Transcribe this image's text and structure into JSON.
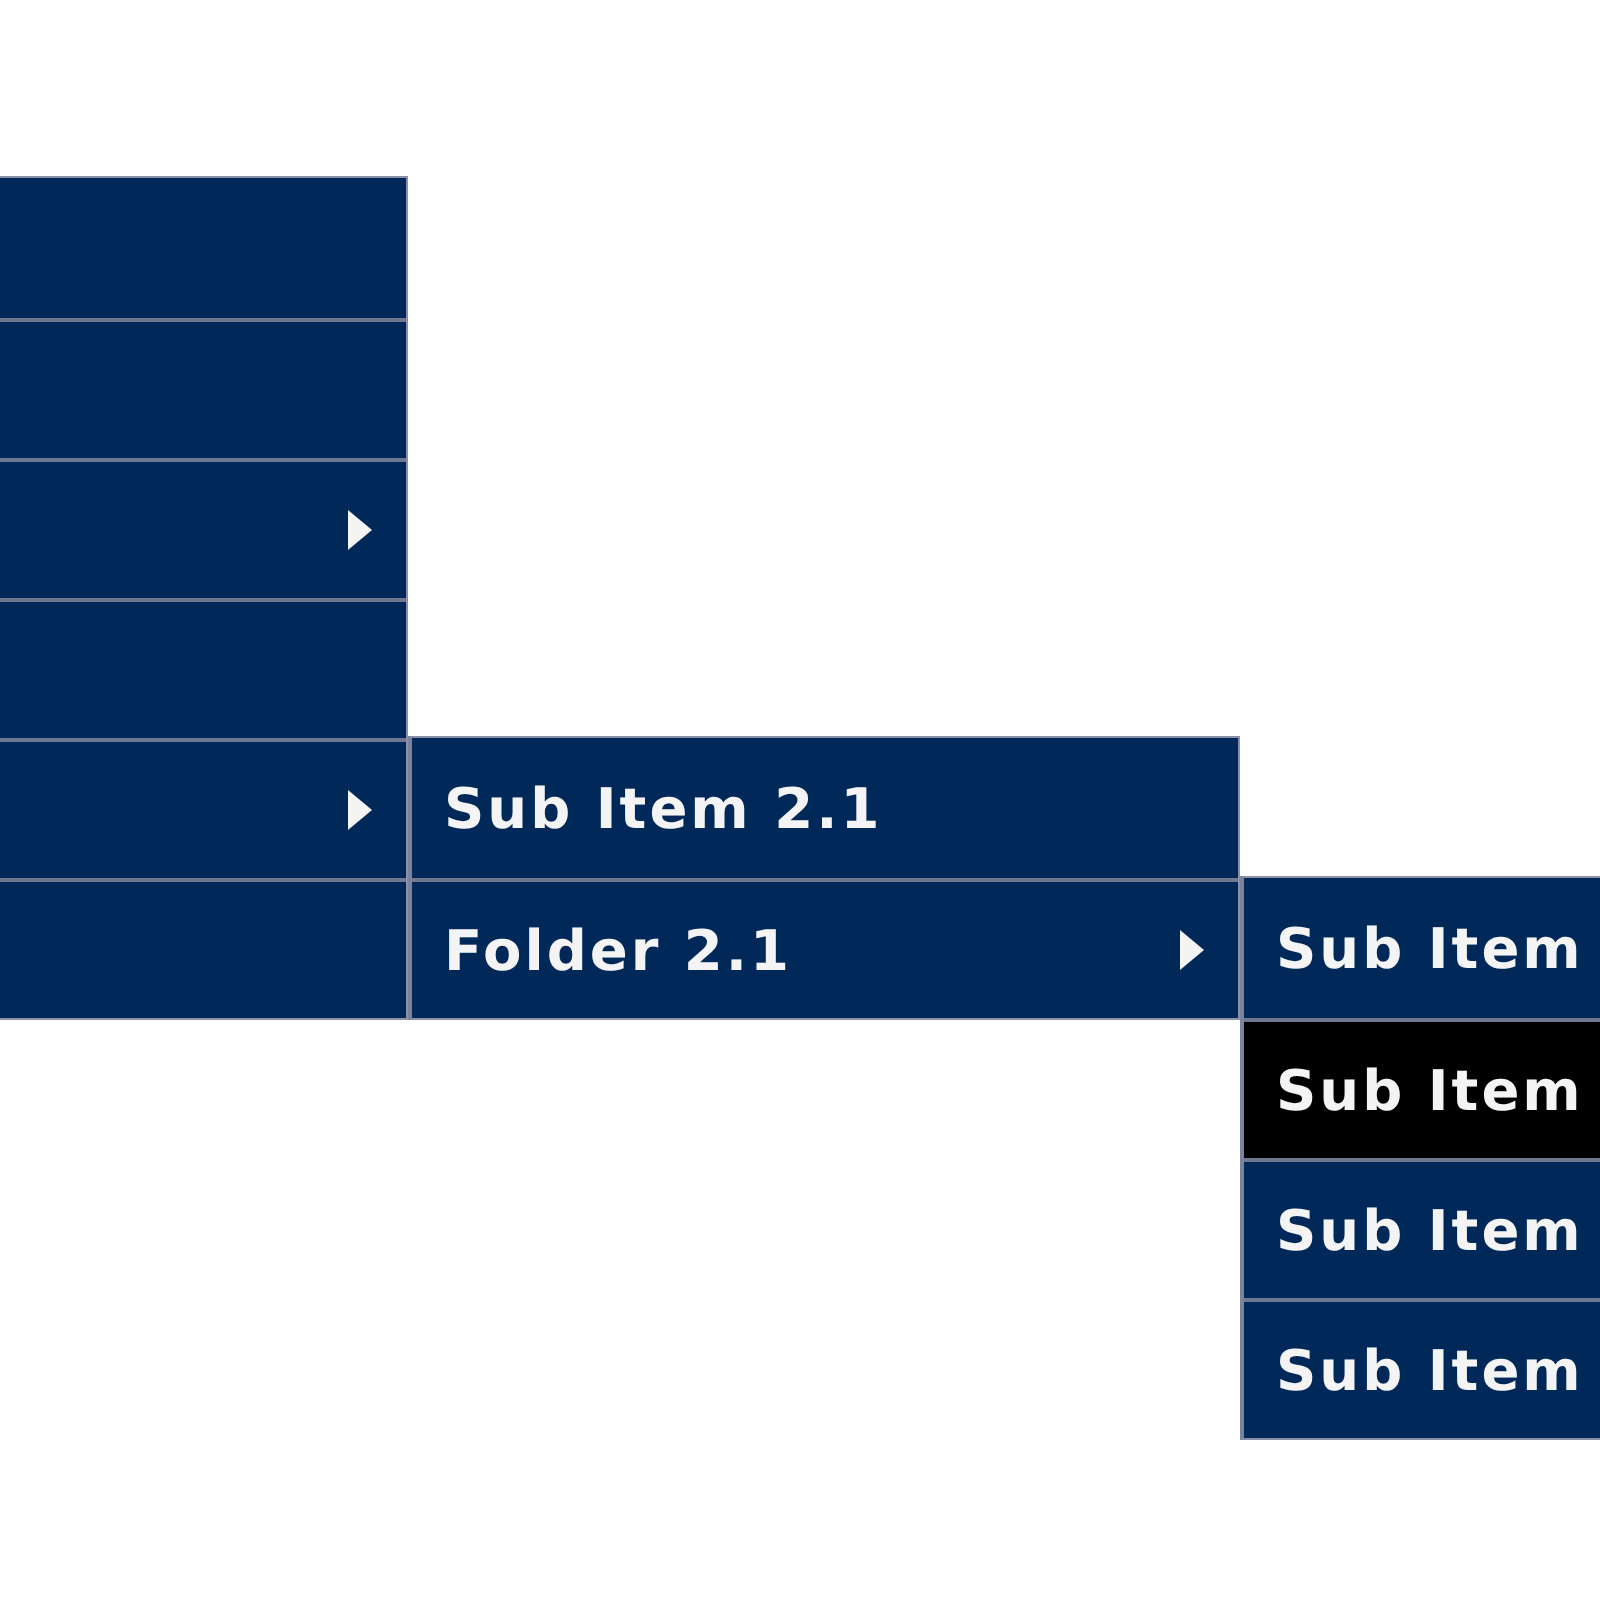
{
  "menu": {
    "items": [
      {
        "has_submenu": false,
        "highlighted": false
      },
      {
        "has_submenu": false,
        "highlighted": false
      },
      {
        "has_submenu": true,
        "highlighted": false
      },
      {
        "has_submenu": false,
        "highlighted": false
      },
      {
        "has_submenu": true,
        "highlighted": false,
        "children": [
          {
            "label": "Sub Item 2.1",
            "has_submenu": false,
            "highlighted": false
          },
          {
            "label": "Folder 2.1",
            "has_submenu": true,
            "highlighted": false,
            "children": [
              {
                "label": "Sub Item",
                "highlighted": false
              },
              {
                "label": "Sub Item",
                "highlighted": true
              },
              {
                "label": "Sub Item",
                "highlighted": false
              },
              {
                "label": "Sub Item",
                "highlighted": false
              }
            ]
          }
        ]
      },
      {
        "has_submenu": false,
        "highlighted": false
      }
    ]
  }
}
